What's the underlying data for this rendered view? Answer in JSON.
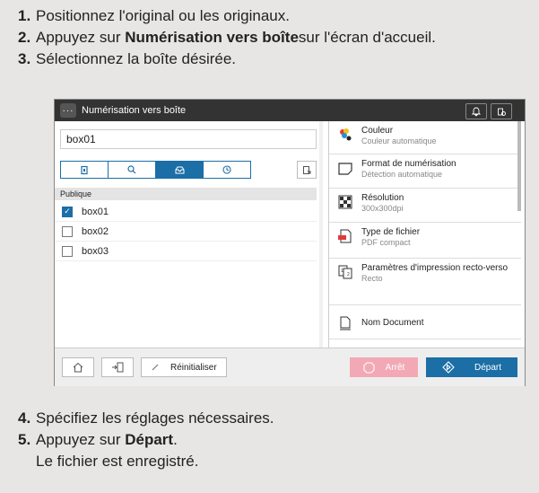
{
  "steps_top": [
    {
      "num": "1.",
      "pre": "Positionnez l'original ou les originaux.",
      "bold": "",
      "post": ""
    },
    {
      "num": "2.",
      "pre": "Appuyez sur ",
      "bold": "Numérisation vers boîte",
      "post": " sur l'écran d'accueil."
    },
    {
      "num": "3.",
      "pre": "Sélectionnez la boîte désirée.",
      "bold": "",
      "post": ""
    }
  ],
  "steps_bottom": [
    {
      "num": "4.",
      "pre": "Spécifiez les réglages nécessaires.",
      "bold": "",
      "post": ""
    },
    {
      "num": "5.",
      "pre": "Appuyez sur ",
      "bold": "Départ",
      "post": "."
    },
    {
      "num": "",
      "pre": "Le fichier est enregistré.",
      "bold": "",
      "post": ""
    }
  ],
  "screen": {
    "title": "Numérisation vers boîte",
    "menu_glyph": "···",
    "box_input_value": "box01",
    "group_label": "Publique",
    "boxes": [
      {
        "label": "box01",
        "checked": true
      },
      {
        "label": "box02",
        "checked": false
      },
      {
        "label": "box03",
        "checked": false
      }
    ],
    "settings": [
      {
        "title": "Couleur",
        "sub": "Couleur automatique",
        "icon": "color-icon"
      },
      {
        "title": "Format de numérisation",
        "sub": "Détection automatique",
        "icon": "scan-size-icon"
      },
      {
        "title": "Résolution",
        "sub": "300x300dpi",
        "icon": "resolution-icon"
      },
      {
        "title": "Type de fichier",
        "sub": "PDF compact",
        "icon": "file-type-icon"
      },
      {
        "title": "Paramètres d'impression recto-verso",
        "sub": "Recto",
        "icon": "duplex-icon"
      },
      {
        "title": "Nom Document",
        "sub": "",
        "icon": "document-name-icon"
      }
    ],
    "reset_label": "Réinitialiser",
    "stop_label": "Arrêt",
    "start_label": "Départ",
    "accent_color": "#1b6ea6",
    "stop_color": "#f2a9b5"
  }
}
